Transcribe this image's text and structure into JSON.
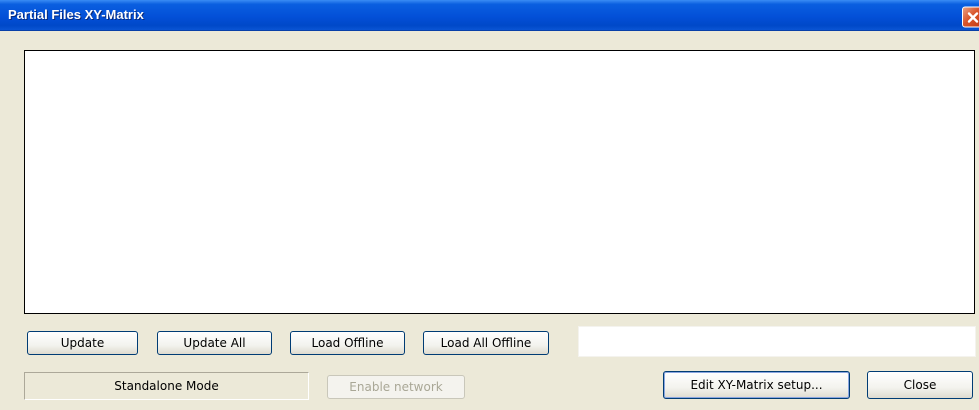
{
  "window": {
    "title": "Partial Files XY-Matrix",
    "close_icon": "close-icon"
  },
  "buttons": {
    "update": "Update",
    "update_all": "Update All",
    "load_offline": "Load Offline",
    "load_all_offline": "Load All Offline",
    "enable_network": "Enable network",
    "edit_setup": "Edit XY-Matrix setup...",
    "close": "Close"
  },
  "status": {
    "mode": "Standalone Mode"
  },
  "colors": {
    "titlebar": "#0350d8",
    "face": "#ece9d8",
    "close_button": "#d9542a"
  }
}
